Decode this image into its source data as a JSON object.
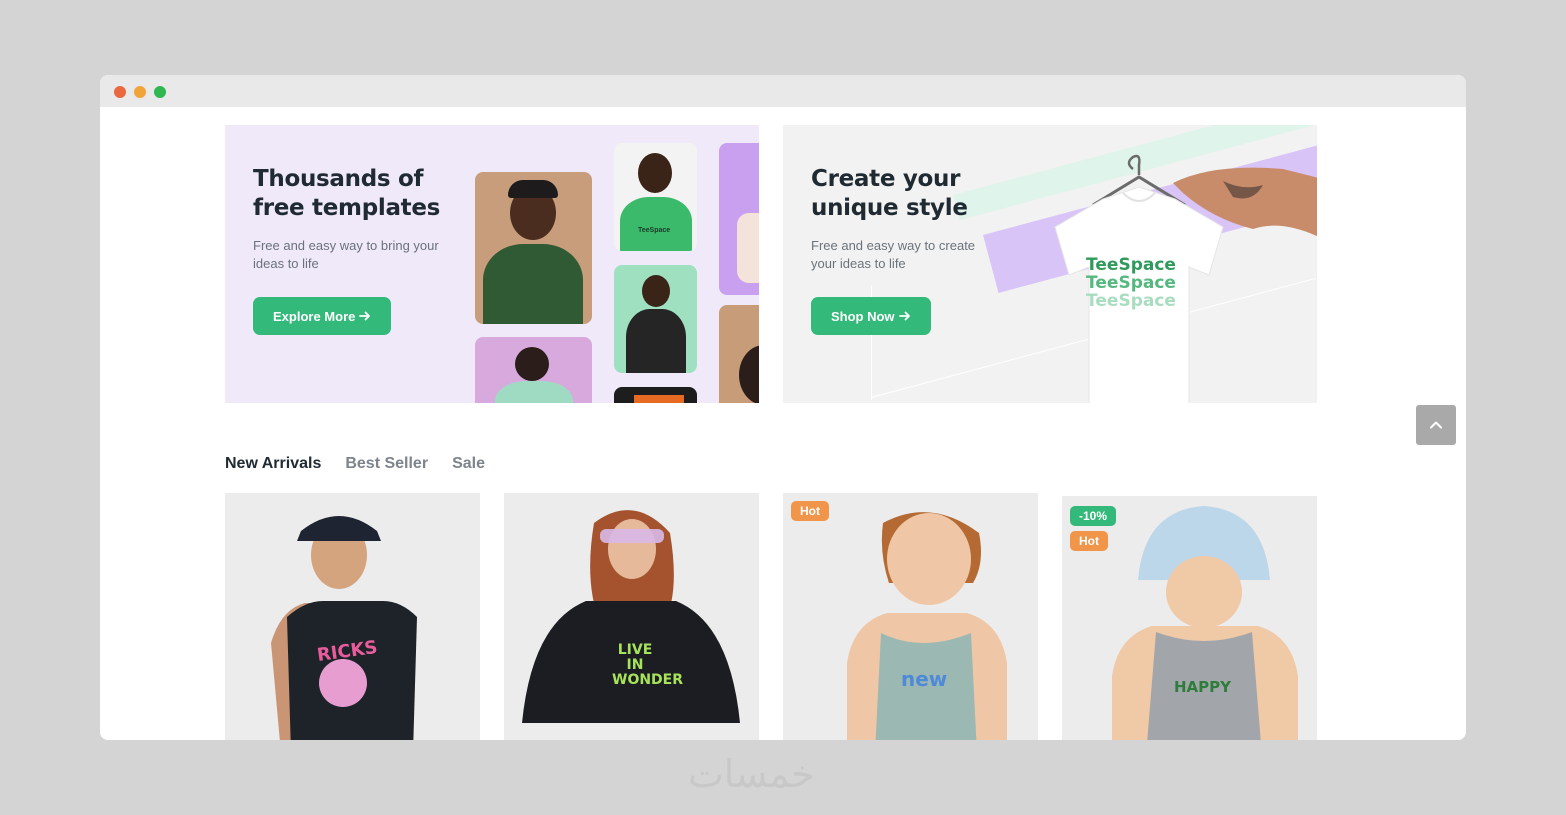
{
  "banners": {
    "left": {
      "title": "Thousands of free templates",
      "description": "Free and easy way to bring your ideas to life",
      "button_label": "Explore More",
      "button_icon": "arrow-right-icon"
    },
    "right": {
      "title": "Create your unique style",
      "description": "Free and easy way to create your ideas to life",
      "button_label": "Shop Now",
      "button_icon": "arrow-right-icon",
      "shirt_text": [
        "TeeSpace",
        "TeeSpace",
        "TeeSpace"
      ]
    }
  },
  "tabs": [
    {
      "label": "New Arrivals",
      "active": true
    },
    {
      "label": "Best Seller",
      "active": false
    },
    {
      "label": "Sale",
      "active": false
    }
  ],
  "products": [
    {
      "badges": [],
      "print_text": "RICKS"
    },
    {
      "badges": [],
      "print_text": "LIVE IN WONDER"
    },
    {
      "badges": [
        "Hot"
      ],
      "print_text": "new"
    },
    {
      "badges": [
        "-10%",
        "Hot"
      ],
      "print_text": "HAPPY"
    }
  ],
  "thumbnail_print": "TeeSpace",
  "scroll_top_icon": "chevron-up-icon",
  "watermark": "خمسات",
  "colors": {
    "accent_green": "#33b97a",
    "badge_hot": "#f0954a",
    "banner_left_bg": "#efe9fa",
    "banner_right_bg": "#f2f2f2"
  }
}
